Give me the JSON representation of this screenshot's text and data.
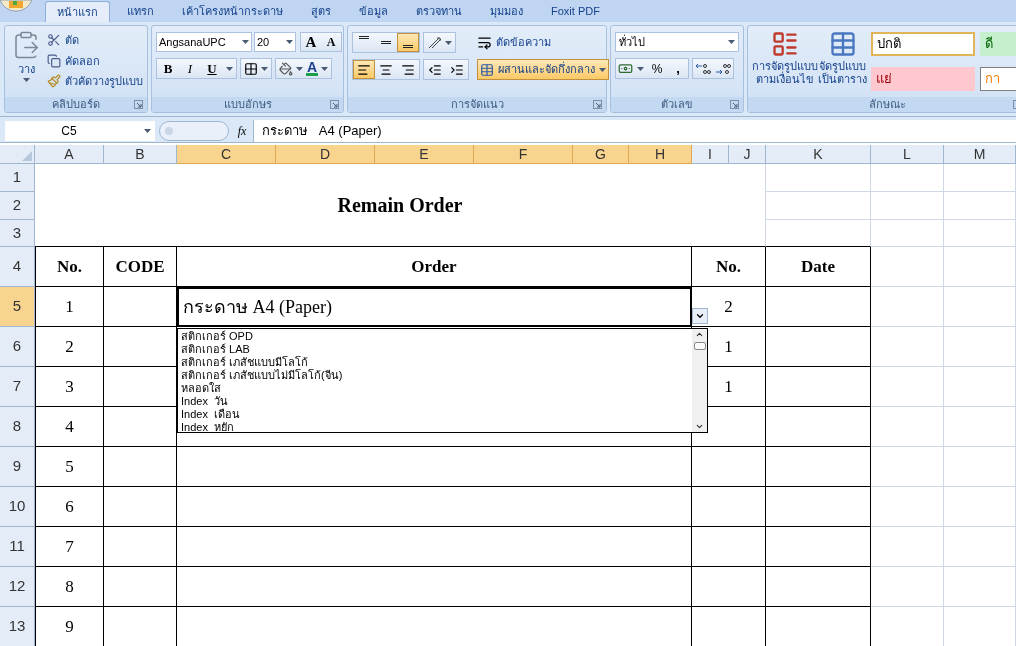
{
  "tabs": [
    {
      "label": "หน้าแรก",
      "selected": true
    },
    {
      "label": "แทรก",
      "selected": false
    },
    {
      "label": "เค้าโครงหน้ากระดาษ",
      "selected": false
    },
    {
      "label": "สูตร",
      "selected": false
    },
    {
      "label": "ข้อมูล",
      "selected": false
    },
    {
      "label": "ตรวจทาน",
      "selected": false
    },
    {
      "label": "มุมมอง",
      "selected": false
    },
    {
      "label": "Foxit PDF",
      "selected": false
    }
  ],
  "ribbon": {
    "clipboard": {
      "title": "คลิปบอร์ด",
      "paste": "วาง",
      "cut": "ตัด",
      "copy": "คัดลอก",
      "format_painter": "ตัวคัดวางรูปแบบ"
    },
    "font": {
      "title": "แบบอักษร",
      "font_name": "AngsanaUPC",
      "font_size": "20",
      "grow": "A",
      "shrink": "A",
      "bold": "B",
      "italic": "I",
      "underline": "U",
      "font_color": "A"
    },
    "alignment": {
      "title": "การจัดแนว",
      "vertical": [
        {
          "selected": false
        },
        {
          "selected": false
        },
        {
          "selected": true
        }
      ],
      "horizontal": [
        {
          "selected": true
        },
        {
          "selected": false
        },
        {
          "selected": false
        }
      ],
      "wrap_text": "ตัดข้อความ",
      "merge_center": {
        "label": "ผสานและจัดกึ่งกลาง",
        "selected": true
      }
    },
    "number": {
      "title": "ตัวเลข",
      "format": "ทั่วไป",
      "percent": "%",
      "comma": ","
    },
    "styles": {
      "title": "ลักษณะ",
      "conditional_formatting": [
        "การจัดรูปแบบ",
        "ตามเงื่อนไข"
      ],
      "format_as_table": [
        "จัดรูปแบบ",
        "เป็นตาราง"
      ],
      "cell_styles": [
        {
          "label": "ปกติ",
          "kind": "normal"
        },
        {
          "label": "ดี",
          "kind": "good"
        },
        {
          "label": "แย่",
          "kind": "bad"
        },
        {
          "label": "กา",
          "kind": "neutral"
        }
      ]
    }
  },
  "formula_bar": {
    "name_box": "C5",
    "fx": "fx",
    "formula": "กระดาษ   A4 (Paper)"
  },
  "sheet": {
    "columns": [
      {
        "label": "A",
        "selected": false
      },
      {
        "label": "B",
        "selected": false
      },
      {
        "label": "C",
        "selected": true
      },
      {
        "label": "D",
        "selected": true
      },
      {
        "label": "E",
        "selected": true
      },
      {
        "label": "F",
        "selected": true
      },
      {
        "label": "G",
        "selected": true
      },
      {
        "label": "H",
        "selected": true
      },
      {
        "label": "I",
        "selected": false
      },
      {
        "label": "J",
        "selected": false
      },
      {
        "label": "K",
        "selected": false
      },
      {
        "label": "L",
        "selected": false
      },
      {
        "label": "M",
        "selected": false
      }
    ],
    "rows": [
      {
        "label": "1",
        "selected": false
      },
      {
        "label": "2",
        "selected": false
      },
      {
        "label": "3",
        "selected": false
      },
      {
        "label": "4",
        "selected": false
      },
      {
        "label": "5",
        "selected": true
      },
      {
        "label": "6",
        "selected": false
      },
      {
        "label": "7",
        "selected": false
      },
      {
        "label": "8",
        "selected": false
      },
      {
        "label": "9",
        "selected": false
      },
      {
        "label": "10",
        "selected": false
      },
      {
        "label": "11",
        "selected": false
      },
      {
        "label": "12",
        "selected": false
      },
      {
        "label": "13",
        "selected": false
      }
    ],
    "title": "Remain Order",
    "headers": [
      "No.",
      "CODE",
      "Order",
      "No.",
      "Date"
    ],
    "records": [
      {
        "no": "1",
        "order": "กระดาษ A4 (Paper)",
        "qty": "2",
        "selected": true
      },
      {
        "no": "2",
        "qty": "1"
      },
      {
        "no": "3",
        "qty": "1"
      },
      {
        "no": "4"
      },
      {
        "no": "5"
      },
      {
        "no": "6"
      },
      {
        "no": "7"
      },
      {
        "no": "8"
      },
      {
        "no": "9"
      }
    ],
    "dropdown": {
      "items": [
        "สติกเกอร์ OPD",
        "สติกเกอร์ LAB",
        "สติกเกอร์ เภสัชแบบมีโลโก้",
        "สติกเกอร์ เภสัชแบบไม่มีโลโก้(จีน)",
        "หลอดใส",
        "Index  วัน",
        "Index  เดือน",
        "Index  หยัก"
      ]
    }
  }
}
